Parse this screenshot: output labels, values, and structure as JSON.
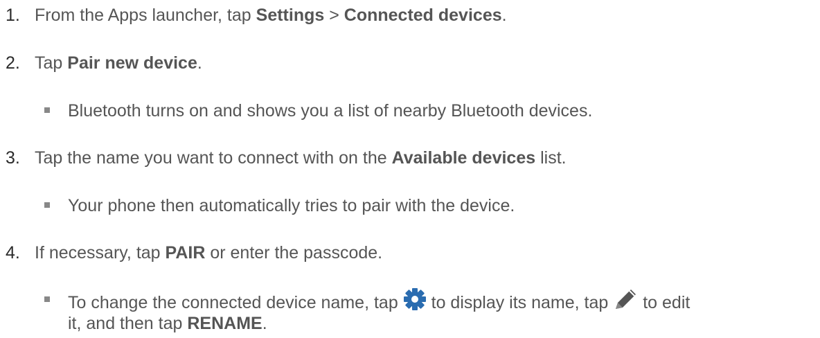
{
  "steps": [
    {
      "number": "1.",
      "parts": [
        "From the Apps launcher, tap ",
        "Settings",
        " > ",
        "Connected devices",
        "."
      ]
    },
    {
      "number": "2.",
      "parts": [
        "Tap ",
        "Pair new device",
        "."
      ],
      "subnote": "Bluetooth turns on and shows you a list of nearby Bluetooth devices."
    },
    {
      "number": "3.",
      "parts": [
        "Tap the name you want to connect with on the ",
        "Available devices",
        " list."
      ],
      "subnote": "Your phone then automatically tries to pair with the device."
    },
    {
      "number": "4.",
      "parts": [
        "If necessary, tap ",
        "PAIR",
        " or enter the passcode."
      ],
      "subnote": {
        "a": "To change the connected device name, tap ",
        "b": " to display its name, tap ",
        "c": " to edit",
        "d": "it, and then tap ",
        "e": "RENAME",
        "f": "."
      }
    }
  ],
  "icons": {
    "settings": "gear-icon",
    "edit": "pencil-icon",
    "accent": "#2a6cb0",
    "pencil_color": "#555555"
  }
}
